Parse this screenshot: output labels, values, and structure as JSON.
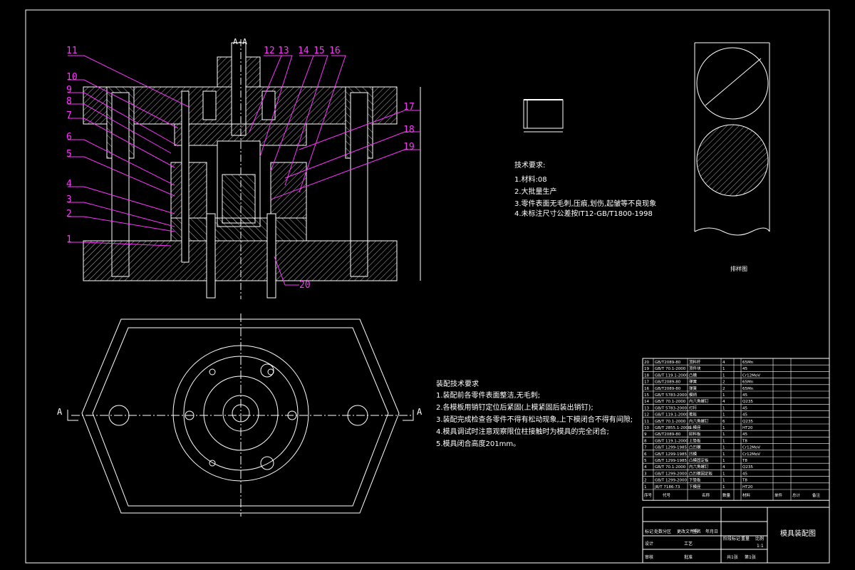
{
  "section_label": "A-A",
  "part_numbers": [
    "1",
    "2",
    "3",
    "4",
    "5",
    "6",
    "7",
    "8",
    "9",
    "10",
    "11",
    "12",
    "13",
    "14",
    "15",
    "16",
    "17",
    "18",
    "19",
    "20"
  ],
  "section_markers": {
    "left": "A",
    "right": "A"
  },
  "blank_notes": {
    "title": "技术要求:",
    "items": [
      "1.材料:08",
      "2.大批量生产",
      "3.零件表面无毛刺,压痕,划伤,起皱等不良现象",
      "4.未标注尺寸公差按IT12-GB/T1800-1998"
    ]
  },
  "assembly_notes": {
    "title": "装配技术要求",
    "items": [
      "1.装配前各零件表面整洁,无毛刺;",
      "2.各模板用销钉定位后紧固(上模紧固后装出销钉);",
      "3.装配完成检查各零件不得有松动现象,上下模闭合不得有间隙;",
      "4.模具调试时注意观察限位柱接触时为模具的完全闭合;",
      "5.模具闭合高度201mm。"
    ]
  },
  "layout_label": "排样图",
  "bom": {
    "rows": [
      {
        "no": "20",
        "std": "GB/T2089-80",
        "name": "顶料杆",
        "qty": "4",
        "mat": "65Mn"
      },
      {
        "no": "19",
        "std": "GB/T 70.1-2000",
        "name": "顶件块",
        "qty": "1",
        "mat": "45"
      },
      {
        "no": "18",
        "std": "GB/T 119.1-2000",
        "name": "凸模",
        "qty": "1",
        "mat": "Cr12MoV"
      },
      {
        "no": "17",
        "std": "GB/T2089-80",
        "name": "弹簧",
        "qty": "2",
        "mat": "65Mn"
      },
      {
        "no": "16",
        "std": "GB/T2089-80",
        "name": "弹簧",
        "qty": "2",
        "mat": "65Mn"
      },
      {
        "no": "15",
        "std": "GB/T 5783-2000",
        "name": "模柄",
        "qty": "1",
        "mat": "45"
      },
      {
        "no": "14",
        "std": "GB/T 70.1-2000",
        "name": "内六角螺钉",
        "qty": "4",
        "mat": "Q235"
      },
      {
        "no": "13",
        "std": "GB/T 5783-2000",
        "name": "打杆",
        "qty": "1",
        "mat": "45"
      },
      {
        "no": "12",
        "std": "GB/T 119.1-2000",
        "name": "推板",
        "qty": "1",
        "mat": "45"
      },
      {
        "no": "11",
        "std": "GB/T 70.1-2000",
        "name": "内六角螺钉",
        "qty": "6",
        "mat": "Q235"
      },
      {
        "no": "10",
        "std": "GB/T 2855.1-2008",
        "name": "上模座",
        "qty": "1",
        "mat": "HT20"
      },
      {
        "no": "9",
        "std": "GB/T2089-80",
        "name": "卸料板",
        "qty": "1",
        "mat": "45"
      },
      {
        "no": "8",
        "std": "GB/T 119.1-2000",
        "name": "上垫板",
        "qty": "1",
        "mat": "T8"
      },
      {
        "no": "7",
        "std": "GB/T 1299-1985",
        "name": "凸凹模",
        "qty": "1",
        "mat": "Cr12MoV"
      },
      {
        "no": "6",
        "std": "GB/T 1299-1985",
        "name": "凹模",
        "qty": "1",
        "mat": "Cr12MoV"
      },
      {
        "no": "5",
        "std": "GB/T 1299-1985",
        "name": "凸模固定板",
        "qty": "1",
        "mat": "T8"
      },
      {
        "no": "4",
        "std": "GB/T 70.1-2000",
        "name": "内六角螺钉",
        "qty": "4",
        "mat": "Q235"
      },
      {
        "no": "3",
        "std": "GB/T 1299-2000",
        "name": "凸凹模固定板",
        "qty": "1",
        "mat": "45"
      },
      {
        "no": "2",
        "std": "GB/T 1299-2000",
        "name": "下垫板",
        "qty": "1",
        "mat": "T8"
      },
      {
        "no": "1",
        "std": "JB/T 7186-73",
        "name": "下模座",
        "qty": "1",
        "mat": "HT20"
      }
    ],
    "header": [
      "序号",
      "代号",
      "名称",
      "数量",
      "材料",
      "单件",
      "总计",
      "备注"
    ]
  },
  "title_block": {
    "drawing_title": "模具装配图",
    "labels": [
      "标记",
      "处数",
      "分区",
      "更改文件号",
      "签名",
      "年月日",
      "设计",
      "审核",
      "工艺",
      "批准",
      "阶段标记",
      "重量",
      "比例",
      "共1张",
      "第1张"
    ],
    "scale": "1:1"
  },
  "colors": {
    "background": "#000000",
    "line": "#ffffff",
    "leader": "#ff33ff"
  }
}
